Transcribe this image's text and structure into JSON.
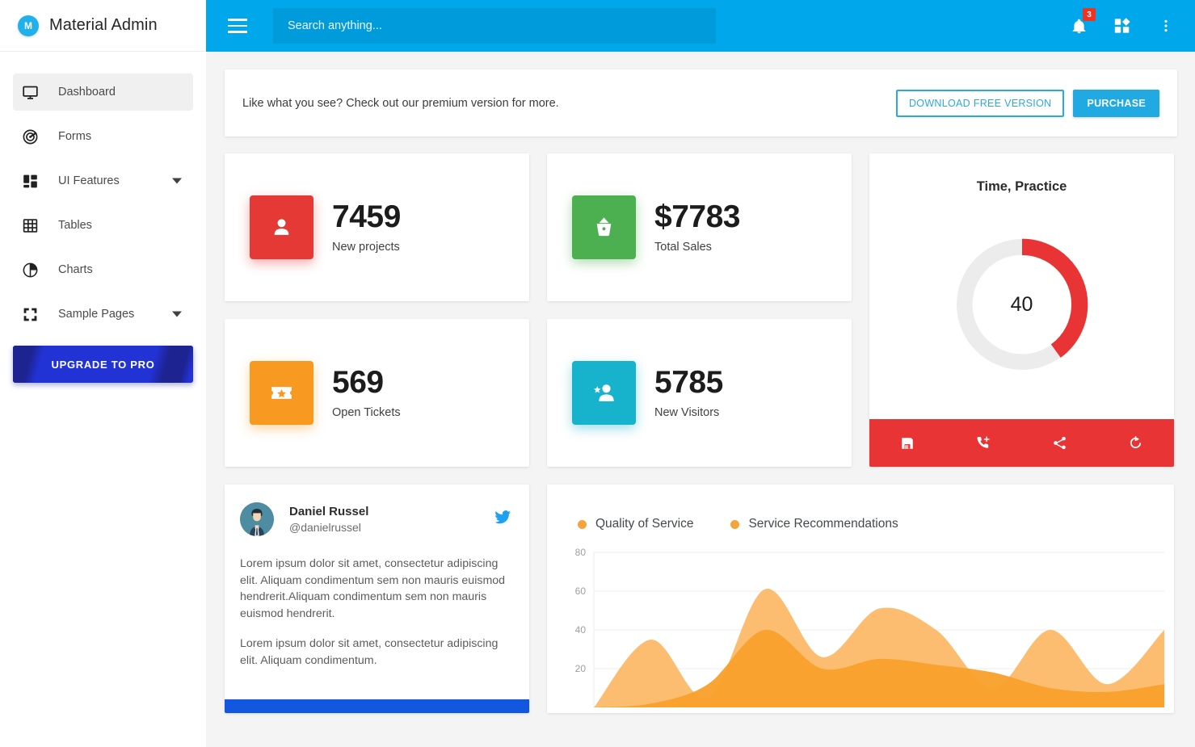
{
  "brand": {
    "logo_letter": "M",
    "title": "Material Admin",
    "logo_color": "#20b0ec"
  },
  "sidebar": {
    "items": [
      {
        "label": "Dashboard",
        "icon": "monitor-icon",
        "active": true,
        "caret": false
      },
      {
        "label": "Forms",
        "icon": "radar-icon",
        "active": false,
        "caret": false
      },
      {
        "label": "UI Features",
        "icon": "layout-icon",
        "active": false,
        "caret": true
      },
      {
        "label": "Tables",
        "icon": "table-icon",
        "active": false,
        "caret": false
      },
      {
        "label": "Charts",
        "icon": "pie-chart-icon",
        "active": false,
        "caret": false
      },
      {
        "label": "Sample Pages",
        "icon": "expand-icon",
        "active": false,
        "caret": true
      }
    ],
    "upgrade_label": "UPGRADE TO PRO"
  },
  "topbar": {
    "background": "#00a7eb",
    "menu_icon": "hamburger-icon",
    "search_placeholder": "Search anything...",
    "search_value": "",
    "notifications_badge": "3",
    "icons": [
      "bell-icon",
      "apps-icon",
      "more-vertical-icon"
    ]
  },
  "promo": {
    "text": "Like what you see? Check out our premium version for more.",
    "download_label": "DOWNLOAD FREE VERSION",
    "purchase_label": "PURCHASE",
    "accent_color": "#21a9e1"
  },
  "stats": [
    {
      "value": "7459",
      "label": "New projects",
      "color": "#e53935",
      "icon": "person-icon"
    },
    {
      "value": "$7783",
      "label": "Total Sales",
      "color": "#4caf50",
      "icon": "basket-icon"
    },
    {
      "value": "569",
      "label": "Open Tickets",
      "color": "#f89a21",
      "icon": "ticket-star-icon"
    },
    {
      "value": "5785",
      "label": "New Visitors",
      "color": "#17b3cd",
      "icon": "person-add-icon"
    }
  ],
  "donut": {
    "title": "Time, Practice",
    "center_value": "40",
    "percent": 40,
    "fill_color": "#e83434",
    "track_color": "#ececec",
    "actions": [
      "save-icon",
      "add-call-icon",
      "share-icon",
      "refresh-icon"
    ],
    "actions_background": "#e83434"
  },
  "tweet": {
    "name": "Daniel Russel",
    "handle": "@danielrussel",
    "network_icon": "twitter-icon",
    "paragraphs": [
      "Lorem ipsum dolor sit amet, consectetur adipiscing elit. Aliquam condimentum sem non mauris euismod hendrerit.Aliquam condimentum sem non mauris euismod hendrerit.",
      "Lorem ipsum dolor sit amet, consectetur adipiscing elit. Aliquam condimentum."
    ],
    "bar_color": "#1157e0"
  },
  "chart_data": {
    "type": "area",
    "title": "",
    "xlabel": "",
    "ylabel": "",
    "ylim": [
      0,
      80
    ],
    "yticks": [
      20,
      40,
      60,
      80
    ],
    "grid": true,
    "legend_position": "top-left",
    "colors": {
      "quality_of_service": "#fbb157",
      "service_recommendations": "#f9a02b"
    },
    "x": [
      0,
      1,
      2,
      3,
      4,
      5,
      6,
      7,
      8,
      9,
      10
    ],
    "series": [
      {
        "name": "Quality of Service",
        "values": [
          0,
          35,
          5,
          61,
          26,
          51,
          40,
          10,
          40,
          12,
          40
        ]
      },
      {
        "name": "Service Recommendations",
        "values": [
          0,
          2,
          12,
          40,
          20,
          25,
          22,
          18,
          10,
          8,
          12
        ]
      }
    ]
  }
}
